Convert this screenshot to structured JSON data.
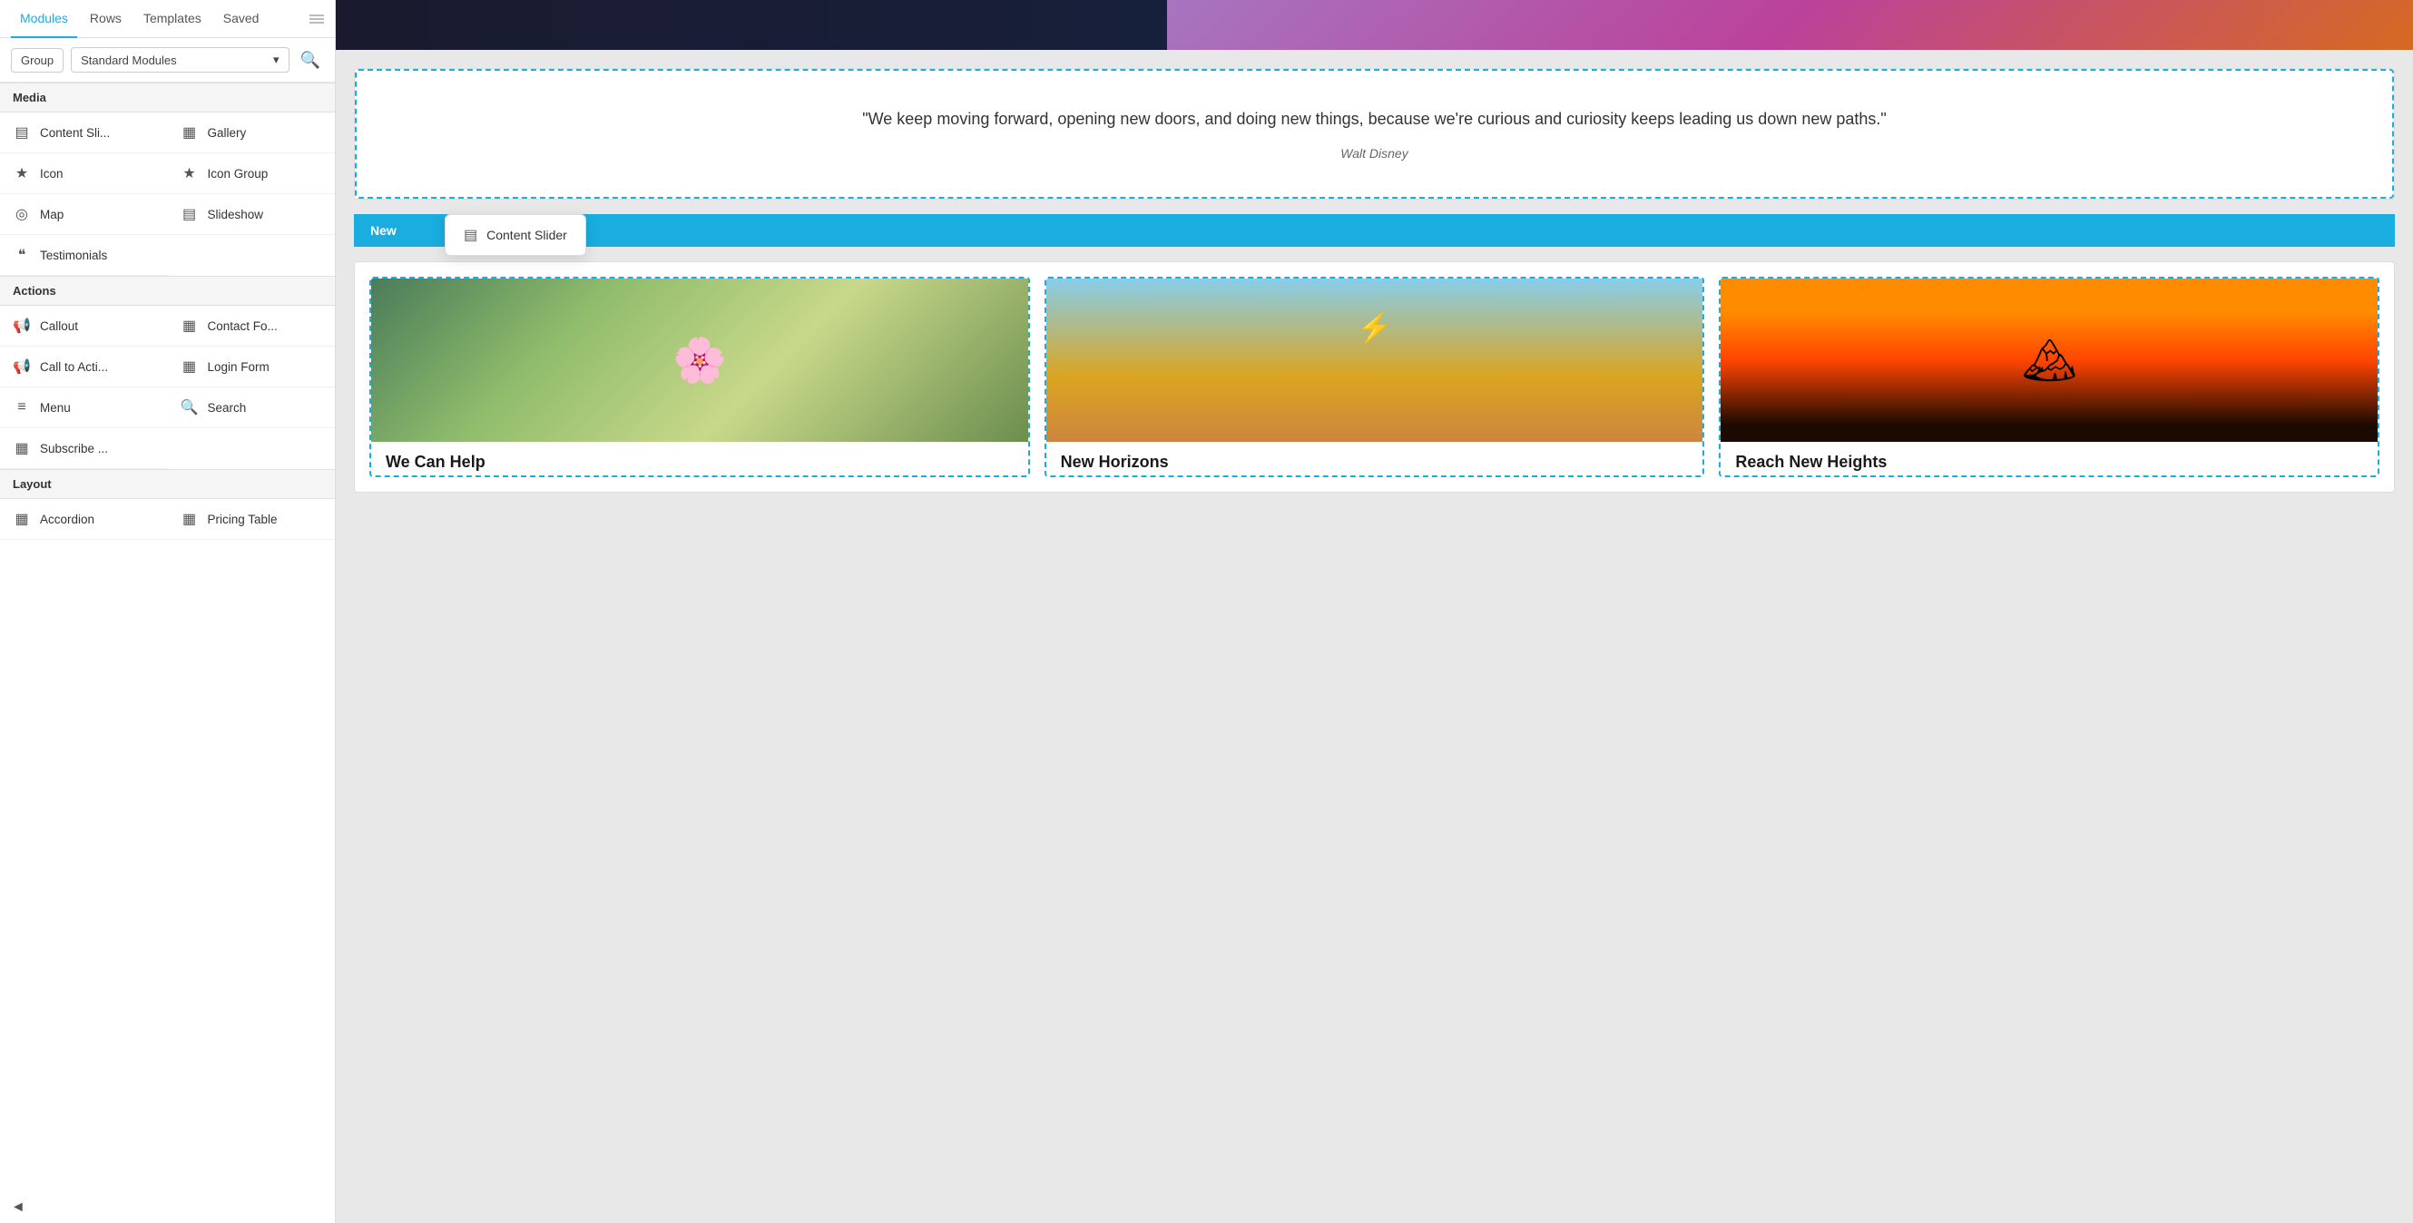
{
  "nav": {
    "tabs": [
      {
        "label": "Modules",
        "active": true
      },
      {
        "label": "Rows",
        "active": false
      },
      {
        "label": "Templates",
        "active": false
      },
      {
        "label": "Saved",
        "active": false
      }
    ]
  },
  "filter": {
    "group_btn": "Group",
    "dropdown_label": "Standard Modules",
    "search_icon": "search-icon"
  },
  "sections": [
    {
      "title": "Media",
      "items": [
        {
          "icon": "▤",
          "label": "Content Sli...",
          "name": "content-slider"
        },
        {
          "icon": "▦",
          "label": "Gallery",
          "name": "gallery"
        },
        {
          "icon": "★",
          "label": "Icon",
          "name": "icon"
        },
        {
          "icon": "★",
          "label": "Icon Group",
          "name": "icon-group"
        },
        {
          "icon": "◉",
          "label": "Map",
          "name": "map"
        },
        {
          "icon": "▤",
          "label": "Slideshow",
          "name": "slideshow"
        },
        {
          "icon": "❝",
          "label": "Testimonials",
          "name": "testimonials"
        }
      ]
    },
    {
      "title": "Actions",
      "items": [
        {
          "icon": "📢",
          "label": "Callout",
          "name": "callout"
        },
        {
          "icon": "▦",
          "label": "Contact Fo...",
          "name": "contact-form"
        },
        {
          "icon": "📢",
          "label": "Call to Acti...",
          "name": "call-to-action"
        },
        {
          "icon": "▦",
          "label": "Login Form",
          "name": "login-form"
        },
        {
          "icon": "≡",
          "label": "Menu",
          "name": "menu"
        },
        {
          "icon": "🔍",
          "label": "Search",
          "name": "search"
        },
        {
          "icon": "▦",
          "label": "Subscribe ...",
          "name": "subscribe"
        }
      ]
    },
    {
      "title": "Layout",
      "items": [
        {
          "icon": "▦",
          "label": "Accordion",
          "name": "accordion"
        },
        {
          "icon": "▦",
          "label": "Pricing Table",
          "name": "pricing-table"
        }
      ]
    }
  ],
  "quote": {
    "text": "\"We keep moving forward, opening new doors, and doing new things, because we're curious and curiosity keeps leading us down new paths.\"",
    "author": "Walt Disney"
  },
  "new_label": "New",
  "content_slider_popup": {
    "icon": "▤",
    "label": "Content Slider"
  },
  "cards": [
    {
      "title": "We Can Help",
      "img_class": "card-img-1"
    },
    {
      "title": "New Horizons",
      "img_class": "card-img-2"
    },
    {
      "title": "Reach New Heights",
      "img_class": "card-img-3"
    }
  ]
}
